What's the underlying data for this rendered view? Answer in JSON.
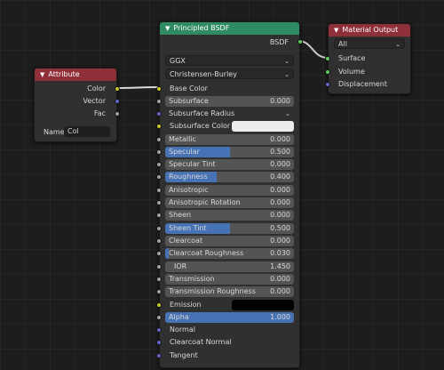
{
  "attribute_node": {
    "title": "Attribute",
    "outputs": [
      "Color",
      "Vector",
      "Fac"
    ],
    "name_label": "Name",
    "name_value": "Col"
  },
  "principled_node": {
    "title": "Principled BSDF",
    "output": "BSDF",
    "distribution": "GGX",
    "subsurface_method": "Christensen-Burley",
    "base_color_label": "Base Color",
    "subsurface": {
      "label": "Subsurface",
      "value": "0.000",
      "fill": 0
    },
    "subsurface_radius": "Subsurface Radius",
    "subsurface_color": {
      "label": "Subsurface Color",
      "color": "#ececec"
    },
    "metallic": {
      "label": "Metallic",
      "value": "0.000",
      "fill": 0
    },
    "specular": {
      "label": "Specular",
      "value": "0.500",
      "fill": 0.5
    },
    "specular_tint": {
      "label": "Specular Tint",
      "value": "0.000",
      "fill": 0
    },
    "roughness": {
      "label": "Roughness",
      "value": "0.400",
      "fill": 0.4
    },
    "anisotropic": {
      "label": "Anisotropic",
      "value": "0.000",
      "fill": 0
    },
    "anisotropic_rotation": {
      "label": "Anisotropic Rotation",
      "value": "0.000",
      "fill": 0
    },
    "sheen": {
      "label": "Sheen",
      "value": "0.000",
      "fill": 0
    },
    "sheen_tint": {
      "label": "Sheen Tint",
      "value": "0.500",
      "fill": 0.5
    },
    "clearcoat": {
      "label": "Clearcoat",
      "value": "0.000",
      "fill": 0
    },
    "clearcoat_roughness": {
      "label": "Clearcoat Roughness",
      "value": "0.030",
      "fill": 0.03
    },
    "ior": {
      "label": "IOR",
      "value": "1.450",
      "fill": 0
    },
    "transmission": {
      "label": "Transmission",
      "value": "0.000",
      "fill": 0
    },
    "transmission_roughness": {
      "label": "Transmission Roughness",
      "value": "0.000",
      "fill": 0
    },
    "emission": {
      "label": "Emission",
      "color": "#000000"
    },
    "alpha": {
      "label": "Alpha",
      "value": "1.000",
      "fill": 1
    },
    "normal": "Normal",
    "clearcoat_normal": "Clearcoat Normal",
    "tangent": "Tangent"
  },
  "output_node": {
    "title": "Material Output",
    "target": "All",
    "inputs": [
      "Surface",
      "Volume",
      "Displacement"
    ]
  },
  "colors": {
    "principled_header": "#2f8b62",
    "attribute_header": "#8e2f3a",
    "output_header": "#8e2f3a",
    "slider_fill": "#4772b3",
    "socket_color": "#c7c729",
    "socket_float": "#a1a1a1",
    "socket_vector": "#6363c7",
    "socket_shader": "#63c763"
  }
}
